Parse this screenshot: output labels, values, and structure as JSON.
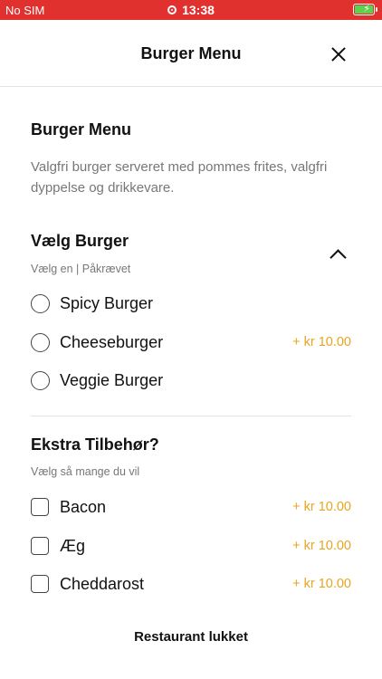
{
  "status_bar": {
    "carrier": "No SIM",
    "time": "13:38"
  },
  "nav": {
    "title": "Burger Menu"
  },
  "item": {
    "title": "Burger Menu",
    "description": "Valgfri burger serveret med pommes frites, valgfri dyppelse og drikkevare."
  },
  "group_burger": {
    "title": "Vælg Burger",
    "subtitle": "Vælg en  |  Påkrævet",
    "options": [
      {
        "label": "Spicy Burger",
        "price": ""
      },
      {
        "label": "Cheeseburger",
        "price": "+ kr 10.00"
      },
      {
        "label": "Veggie Burger",
        "price": ""
      }
    ]
  },
  "group_extra": {
    "title": "Ekstra Tilbehør?",
    "subtitle": "Vælg så mange du vil",
    "options": [
      {
        "label": "Bacon",
        "price": "+ kr 10.00"
      },
      {
        "label": "Æg",
        "price": "+ kr 10.00"
      },
      {
        "label": "Cheddarost",
        "price": "+ kr 10.00"
      }
    ]
  },
  "footer": {
    "label": "Restaurant lukket"
  },
  "colors": {
    "status_bar": "#e0312f",
    "price": "#e8a51f",
    "battery": "#5cd24f"
  }
}
